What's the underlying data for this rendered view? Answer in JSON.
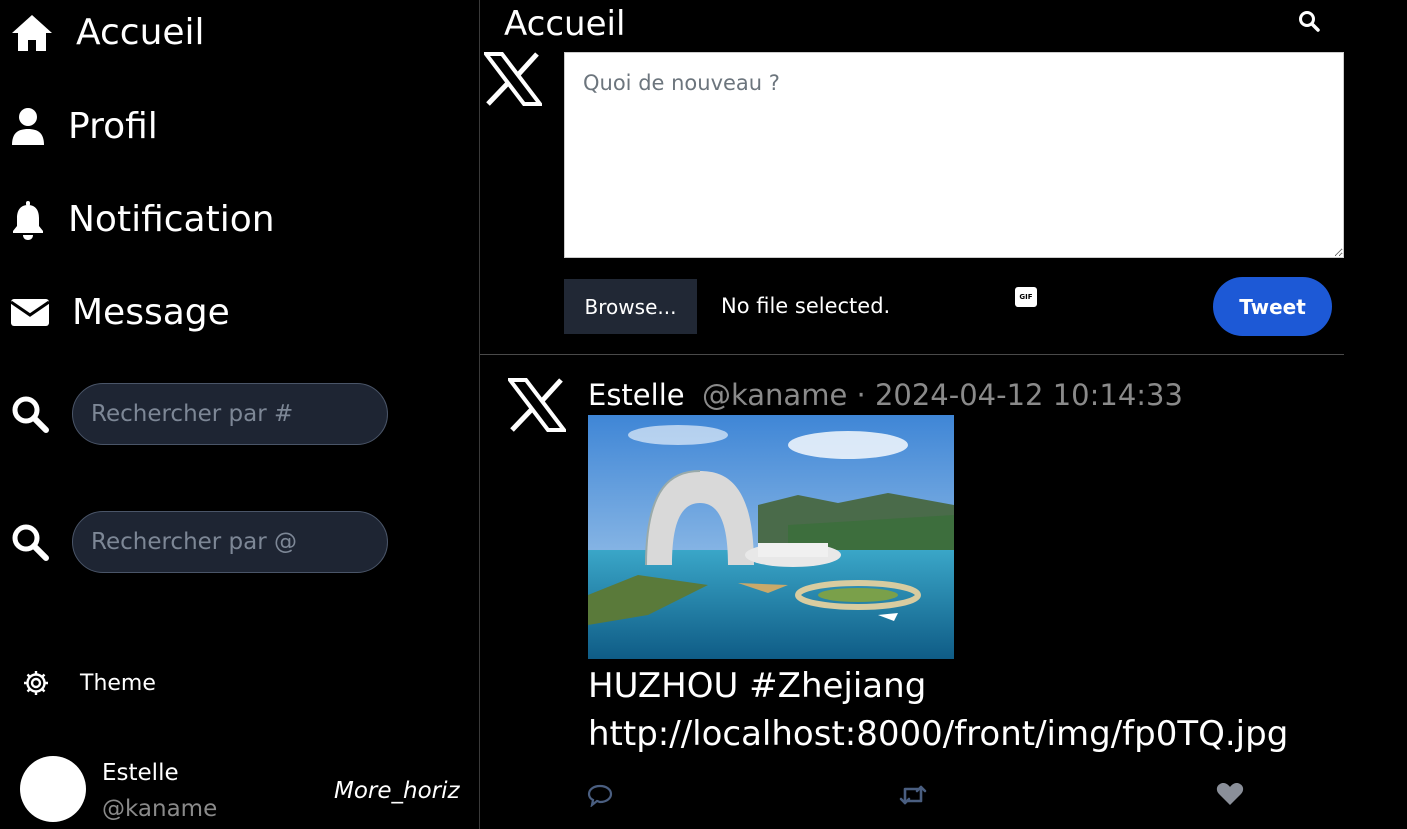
{
  "sidebar": {
    "nav": [
      {
        "label": "Accueil",
        "icon": "home-icon"
      },
      {
        "label": "Profil",
        "icon": "user-icon"
      },
      {
        "label": "Notification",
        "icon": "bell-icon"
      },
      {
        "label": "Message",
        "icon": "envelope-icon"
      }
    ],
    "search_hashtag_placeholder": "Rechercher par #",
    "search_user_placeholder": "Rechercher par @",
    "theme_label": "Theme",
    "account": {
      "name": "Estelle",
      "handle": "@kaname",
      "more_label": "More_horiz"
    }
  },
  "main": {
    "title": "Accueil",
    "compose": {
      "placeholder": "Quoi de nouveau ?",
      "browse_label": "Browse...",
      "file_status": "No file selected.",
      "gif_label": "GIF",
      "tweet_label": "Tweet"
    },
    "tweets": [
      {
        "author": "Estelle",
        "meta": "@kaname · 2024-04-12 10:14:33",
        "text": "HUZHOU #Zhejiang http://localhost:8000/front/img/fp0TQ.jpg"
      }
    ]
  },
  "colors": {
    "background": "#000000",
    "accent": "#1d59d6",
    "search_bg": "#1e2533",
    "muted_text": "#8a8a8a"
  }
}
